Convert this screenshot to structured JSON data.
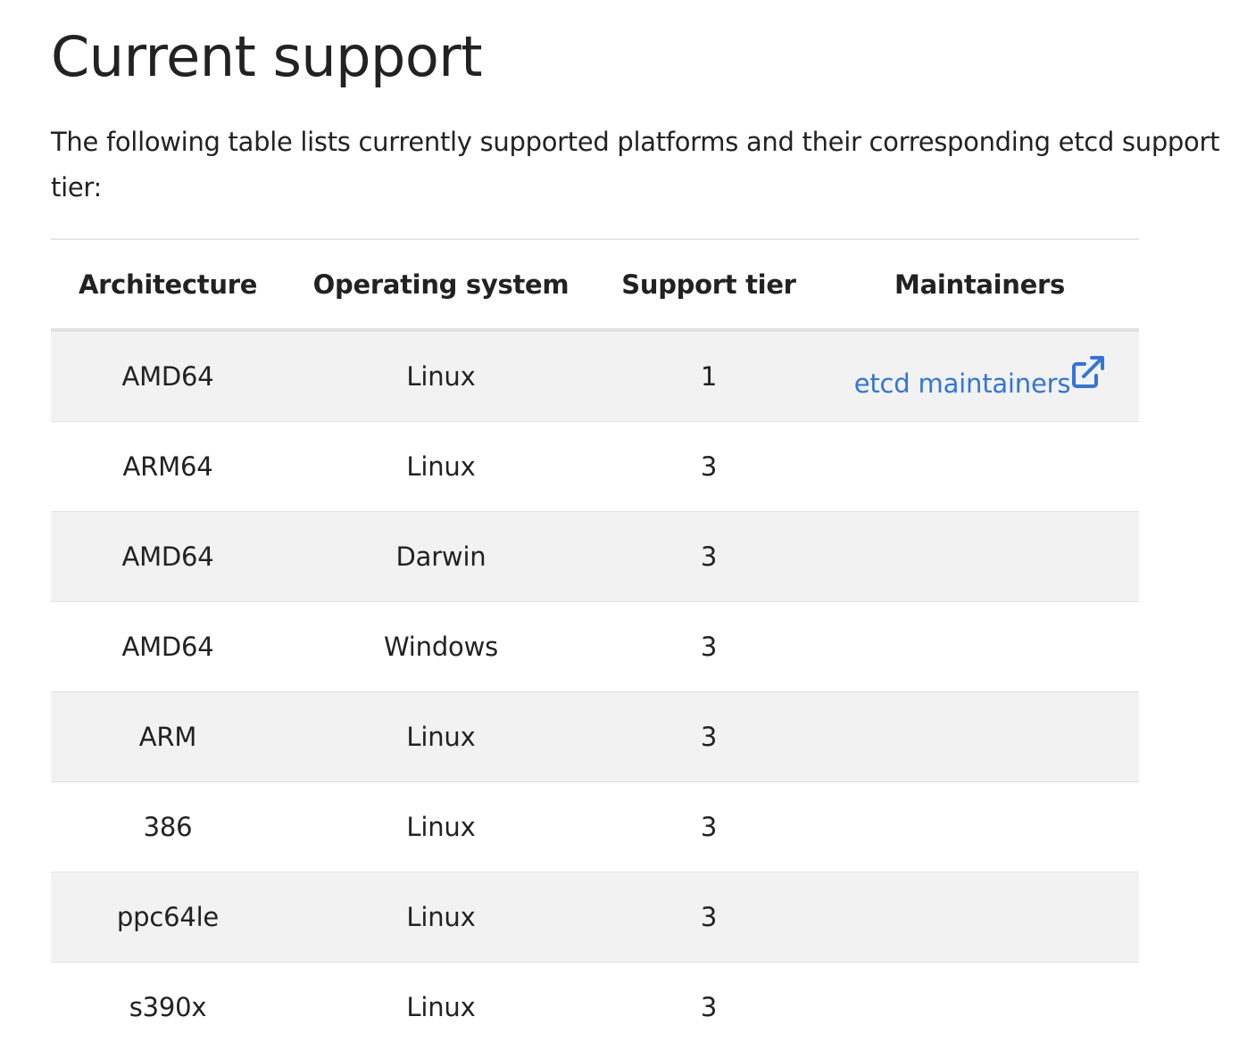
{
  "page": {
    "title": "Current support",
    "intro": "The following table lists currently supported platforms and their corresponding etcd support tier:"
  },
  "table": {
    "headers": [
      "Architecture",
      "Operating system",
      "Support tier",
      "Maintainers"
    ],
    "rows": [
      {
        "architecture": "AMD64",
        "os": "Linux",
        "tier": "1",
        "maintainers": "etcd maintainers"
      },
      {
        "architecture": "ARM64",
        "os": "Linux",
        "tier": "3",
        "maintainers": ""
      },
      {
        "architecture": "AMD64",
        "os": "Darwin",
        "tier": "3",
        "maintainers": ""
      },
      {
        "architecture": "AMD64",
        "os": "Windows",
        "tier": "3",
        "maintainers": ""
      },
      {
        "architecture": "ARM",
        "os": "Linux",
        "tier": "3",
        "maintainers": ""
      },
      {
        "architecture": "386",
        "os": "Linux",
        "tier": "3",
        "maintainers": ""
      },
      {
        "architecture": "ppc64le",
        "os": "Linux",
        "tier": "3",
        "maintainers": ""
      },
      {
        "architecture": "s390x",
        "os": "Linux",
        "tier": "3",
        "maintainers": ""
      }
    ],
    "external_link_icon": "external-link-icon"
  },
  "colors": {
    "link": "#3176d9",
    "stripe": "#f2f2f2",
    "text": "#222222"
  }
}
